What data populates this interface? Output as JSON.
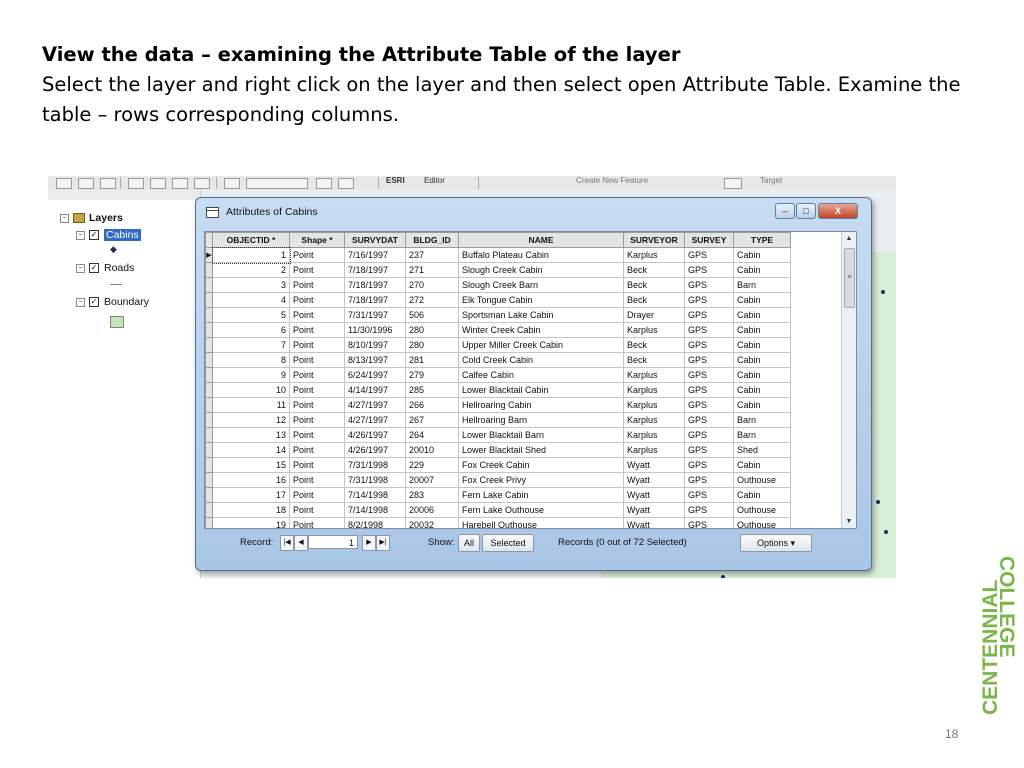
{
  "slide": {
    "title": "View the data – examining the Attribute Table of the layer",
    "body": "Select the layer and right click on the layer and then select open Attribute Table. Examine the table – rows corresponding columns.",
    "page_number": "18"
  },
  "logo": {
    "line1": "CENTENNIAL",
    "line2": "COLLEGE",
    "color": "#7ab648"
  },
  "toolbar": {
    "editor_label": "Editor",
    "create_feature": "Create New Feature",
    "target": "Target"
  },
  "toc": {
    "root": "Layers",
    "layers": [
      {
        "name": "Cabins",
        "checked": true,
        "selected": true
      },
      {
        "name": "Roads",
        "checked": true,
        "selected": false
      },
      {
        "name": "Boundary",
        "checked": true,
        "selected": false
      }
    ]
  },
  "window": {
    "title": "Attributes of Cabins",
    "buttons": {
      "minimize": "–",
      "maximize": "□",
      "close": "X"
    }
  },
  "table": {
    "columns": [
      "OBJECTID *",
      "Shape *",
      "SURVYDAT",
      "BLDG_ID",
      "NAME",
      "SURVEYOR",
      "SURVEY",
      "TYPE"
    ],
    "rows": [
      [
        "1",
        "Point",
        "7/16/1997",
        "237",
        "Buffalo Plateau Cabin",
        "Karplus",
        "GPS",
        "Cabin"
      ],
      [
        "2",
        "Point",
        "7/18/1997",
        "271",
        "Slough Creek Cabin",
        "Beck",
        "GPS",
        "Cabin"
      ],
      [
        "3",
        "Point",
        "7/18/1997",
        "270",
        "Slough Creek Barn",
        "Beck",
        "GPS",
        "Barn"
      ],
      [
        "4",
        "Point",
        "7/18/1997",
        "272",
        "Elk Tongue Cabin",
        "Beck",
        "GPS",
        "Cabin"
      ],
      [
        "5",
        "Point",
        "7/31/1997",
        "506",
        "Sportsman Lake Cabin",
        "Drayer",
        "GPS",
        "Cabin"
      ],
      [
        "6",
        "Point",
        "11/30/1996",
        "280",
        "Winter Creek Cabin",
        "Karplus",
        "GPS",
        "Cabin"
      ],
      [
        "7",
        "Point",
        "8/10/1997",
        "280",
        "Upper Miller Creek Cabin",
        "Beck",
        "GPS",
        "Cabin"
      ],
      [
        "8",
        "Point",
        "8/13/1997",
        "281",
        "Cold Creek Cabin",
        "Beck",
        "GPS",
        "Cabin"
      ],
      [
        "9",
        "Point",
        "6/24/1997",
        "279",
        "Calfee Cabin",
        "Karplus",
        "GPS",
        "Cabin"
      ],
      [
        "10",
        "Point",
        "4/14/1997",
        "285",
        "Lower Blacktail Cabin",
        "Karplus",
        "GPS",
        "Cabin"
      ],
      [
        "11",
        "Point",
        "4/27/1997",
        "266",
        "Hellroaring Cabin",
        "Karplus",
        "GPS",
        "Cabin"
      ],
      [
        "12",
        "Point",
        "4/27/1997",
        "267",
        "Hellroaring Barn",
        "Karplus",
        "GPS",
        "Barn"
      ],
      [
        "13",
        "Point",
        "4/26/1997",
        "264",
        "Lower Blacktail Barn",
        "Karplus",
        "GPS",
        "Barn"
      ],
      [
        "14",
        "Point",
        "4/26/1997",
        "20010",
        "Lower Blacktail Shed",
        "Karplus",
        "GPS",
        "Shed"
      ],
      [
        "15",
        "Point",
        "7/31/1998",
        "229",
        "Fox Creek Cabin",
        "Wyatt",
        "GPS",
        "Cabin"
      ],
      [
        "16",
        "Point",
        "7/31/1998",
        "20007",
        "Fox Creek Privy",
        "Wyatt",
        "GPS",
        "Outhouse"
      ],
      [
        "17",
        "Point",
        "7/14/1998",
        "283",
        "Fern Lake Cabin",
        "Wyatt",
        "GPS",
        "Cabin"
      ],
      [
        "18",
        "Point",
        "7/14/1998",
        "20006",
        "Fern Lake Outhouse",
        "Wyatt",
        "GPS",
        "Outhouse"
      ],
      [
        "19",
        "Point",
        "8/2/1998",
        "20032",
        "Harebell Outhouse",
        "Wyatt",
        "GPS",
        "Outhouse"
      ]
    ]
  },
  "status": {
    "record_label": "Record:",
    "record_value": "1",
    "show_label": "Show:",
    "all_label": "All",
    "selected_label": "Selected",
    "records_text": "Records (0 out of 72 Selected)",
    "options_label": "Options ▾"
  }
}
